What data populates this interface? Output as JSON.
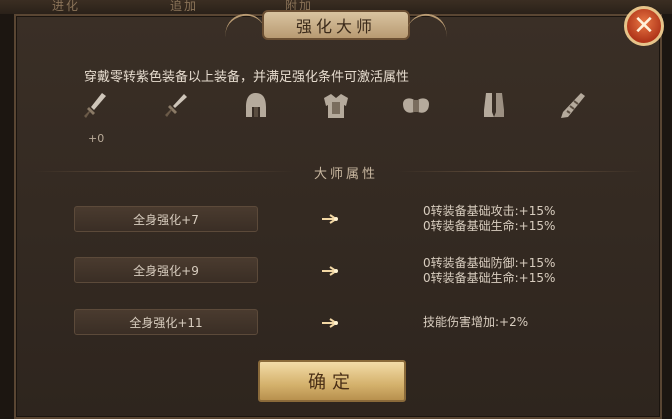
{
  "background_tabs": [
    "进化",
    "追加",
    "附加"
  ],
  "dialog": {
    "title": "强化大师",
    "close_label": "✕",
    "description": "穿戴零转紫色装备以上装备，并满足强化条件可激活属性",
    "equipment_slots": [
      {
        "icon": "sword-icon",
        "level": "+0"
      },
      {
        "icon": "dagger-icon"
      },
      {
        "icon": "helmet-icon"
      },
      {
        "icon": "chest-armor-icon"
      },
      {
        "icon": "pauldron-icon"
      },
      {
        "icon": "boots-icon"
      },
      {
        "icon": "bracer-icon"
      }
    ],
    "section_title": "大师属性",
    "attributes": [
      {
        "requirement": "全身强化+7",
        "effects": [
          "0转装备基础攻击:+15%",
          "0转装备基础生命:+15%"
        ]
      },
      {
        "requirement": "全身强化+9",
        "effects": [
          "0转装备基础防御:+15%",
          "0转装备基础生命:+15%"
        ]
      },
      {
        "requirement": "全身强化+11",
        "effects": [
          "技能伤害增加:+2%"
        ]
      }
    ],
    "confirm_label": "确定"
  },
  "colors": {
    "panel_bg": "#2e251e",
    "accent_gold": "#d4b16c",
    "close_red": "#b1361a",
    "text_light": "#e6dccf"
  }
}
